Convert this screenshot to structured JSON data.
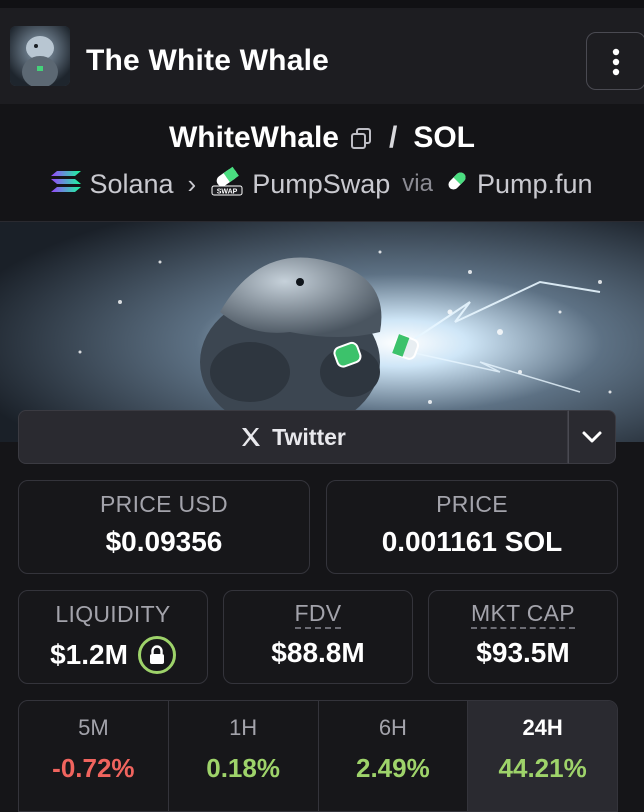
{
  "header": {
    "title": "The White Whale",
    "menu_icon": "kebab-vertical-icon"
  },
  "pair": {
    "base": "WhiteWhale",
    "separator": "/",
    "quote": "SOL",
    "chain": "Solana",
    "dex": "PumpSwap",
    "via": "via",
    "launchpad": "Pump.fun",
    "swap_badge": "SWAP"
  },
  "twitter": {
    "label": "Twitter"
  },
  "stats": {
    "price_usd_label": "PRICE USD",
    "price_usd": "$0.09356",
    "price_label": "PRICE",
    "price": "0.001161 SOL",
    "liquidity_label": "LIQUIDITY",
    "liquidity": "$1.2M",
    "fdv_label": "FDV",
    "fdv": "$88.8M",
    "mktcap_label": "MKT CAP",
    "mktcap": "$93.5M"
  },
  "changes": [
    {
      "tf": "5M",
      "pct": "-0.72%"
    },
    {
      "tf": "1H",
      "pct": "0.18%"
    },
    {
      "tf": "6H",
      "pct": "2.49%"
    },
    {
      "tf": "24H",
      "pct": "44.21%"
    }
  ],
  "colors": {
    "positive": "#9ed36a",
    "negative": "#f0645e",
    "background": "#151518"
  }
}
